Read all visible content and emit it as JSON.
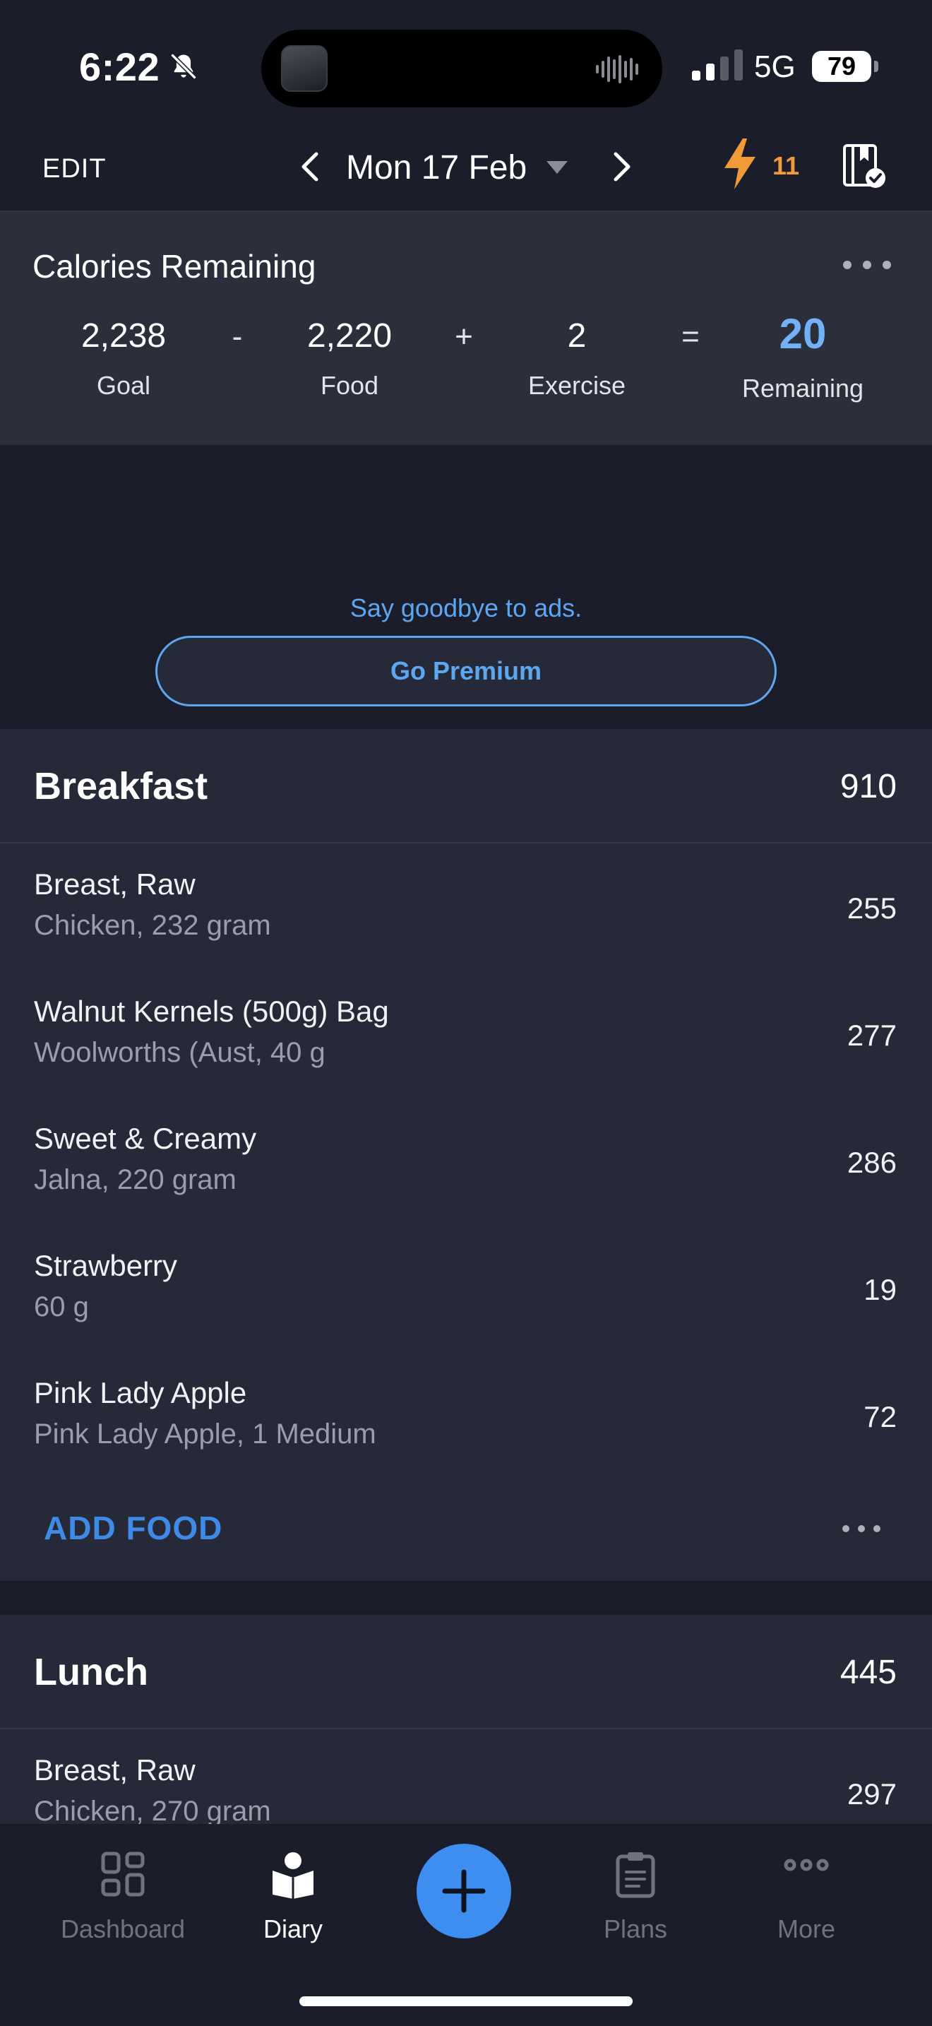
{
  "status_bar": {
    "time": "6:22",
    "network": "5G",
    "battery": "79"
  },
  "nav": {
    "edit_label": "EDIT",
    "date": "Mon 17 Feb",
    "streak": "11"
  },
  "calories": {
    "title": "Calories Remaining",
    "goal": {
      "value": "2,238",
      "label": "Goal"
    },
    "food": {
      "value": "2,220",
      "label": "Food"
    },
    "exercise": {
      "value": "2",
      "label": "Exercise"
    },
    "remaining": {
      "value": "20",
      "label": "Remaining"
    },
    "ops": [
      "-",
      "+",
      "="
    ]
  },
  "ad": {
    "text": "Say goodbye to ads.",
    "button": "Go Premium"
  },
  "breakfast": {
    "name": "Breakfast",
    "total": "910",
    "items": [
      {
        "name": "Breast, Raw",
        "detail": "Chicken, 232 gram",
        "cal": "255"
      },
      {
        "name": "Walnut Kernels (500g) Bag",
        "detail": "Woolworths (Aust, 40 g",
        "cal": "277"
      },
      {
        "name": "Sweet & Creamy",
        "detail": "Jalna, 220 gram",
        "cal": "286"
      },
      {
        "name": "Strawberry",
        "detail": "60 g",
        "cal": "19"
      },
      {
        "name": "Pink Lady Apple",
        "detail": "Pink Lady Apple, 1 Medium",
        "cal": "72"
      }
    ],
    "add_label": "ADD FOOD"
  },
  "lunch": {
    "name": "Lunch",
    "total": "445",
    "items": [
      {
        "name": "Breast, Raw",
        "detail": "Chicken, 270 gram",
        "cal": "297"
      }
    ]
  },
  "tabs": [
    {
      "label": "Dashboard",
      "icon": "dashboard-icon"
    },
    {
      "label": "Diary",
      "icon": "diary-icon"
    },
    {
      "label": "Plans",
      "icon": "clipboard-icon"
    },
    {
      "label": "More",
      "icon": "more-dots-icon"
    }
  ],
  "colors": {
    "accent": "#3d8ef0",
    "remaining": "#72b1f5",
    "streak": "#f29a37",
    "background": "#262937"
  }
}
